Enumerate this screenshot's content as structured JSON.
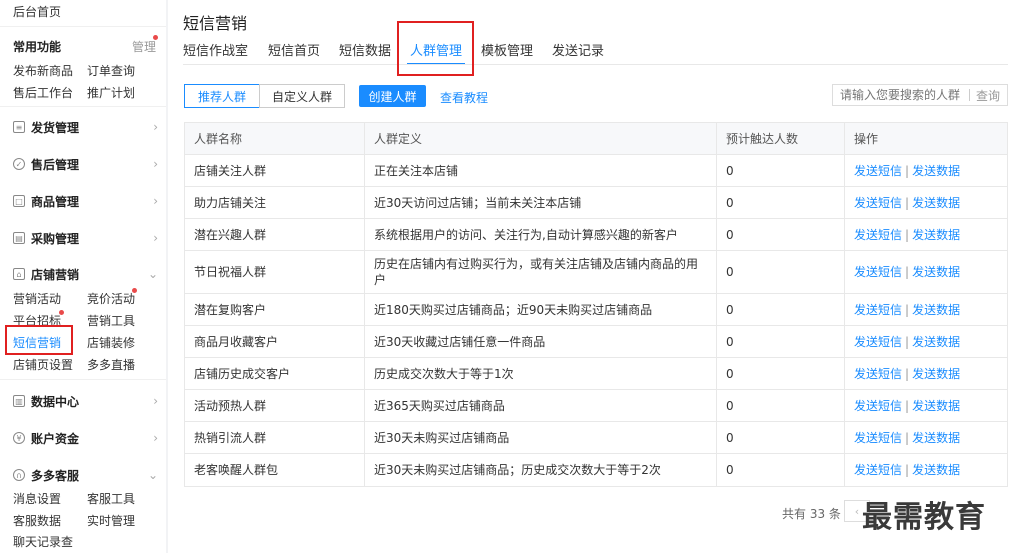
{
  "sidebar": {
    "top_link": "后台首页",
    "common": {
      "title": "常用功能",
      "manage": "管理",
      "links": [
        "发布新商品",
        "订单查询",
        "售后工作台",
        "推广计划"
      ]
    },
    "groups": {
      "shipping": "发货管理",
      "aftersale": "售后管理",
      "goods": "商品管理",
      "purchase": "采购管理",
      "store": "店铺营销",
      "data": "数据中心",
      "account": "账户资金",
      "service": "多多客服"
    },
    "store_links": [
      "营销活动",
      "竞价活动",
      "平台招标",
      "营销工具",
      "短信营销",
      "店铺装修",
      "店铺页设置",
      "多多直播"
    ],
    "service_links": [
      "消息设置",
      "客服工具",
      "客服数据",
      "实时管理",
      "聊天记录查"
    ]
  },
  "main": {
    "title": "短信营销",
    "tabs": [
      "短信作战室",
      "短信首页",
      "短信数据",
      "人群管理",
      "模板管理",
      "发送记录"
    ],
    "active_tab": "人群管理",
    "seg_buttons": [
      "推荐人群",
      "自定义人群"
    ],
    "create_button": "创建人群",
    "tutorial_link": "查看教程",
    "search": {
      "placeholder": "请输入您要搜索的人群",
      "button": "查询"
    },
    "table": {
      "headers": [
        "人群名称",
        "人群定义",
        "预计触达人数",
        "操作"
      ],
      "op_send_sms": "发送短信",
      "op_send_data": "发送数据",
      "rows": [
        {
          "name": "店铺关注人群",
          "def": "正在关注本店铺",
          "count": "0"
        },
        {
          "name": "助力店铺关注",
          "def": "近30天访问过店铺；当前未关注本店铺",
          "count": "0"
        },
        {
          "name": "潜在兴趣人群",
          "def": "系统根据用户的访问、关注行为,自动计算感兴趣的新客户",
          "count": "0"
        },
        {
          "name": "节日祝福人群",
          "def": "历史在店铺内有过购买行为，或有关注店铺及店铺内商品的用户",
          "count": "0"
        },
        {
          "name": "潜在复购客户",
          "def": "近180天购买过店铺商品；近90天未购买过店铺商品",
          "count": "0"
        },
        {
          "name": "商品月收藏客户",
          "def": "近30天收藏过店铺任意一件商品",
          "count": "0"
        },
        {
          "name": "店铺历史成交客户",
          "def": "历史成交次数大于等于1次",
          "count": "0"
        },
        {
          "name": "活动预热人群",
          "def": "近365天购买过店铺商品",
          "count": "0"
        },
        {
          "name": "热销引流人群",
          "def": "近30天未购买过店铺商品",
          "count": "0"
        },
        {
          "name": "老客唤醒人群包",
          "def": "近30天未购买过店铺商品；历史成交次数大于等于2次",
          "count": "0"
        }
      ]
    },
    "total_text": "共有 33 条",
    "watermark": "最需教育"
  }
}
